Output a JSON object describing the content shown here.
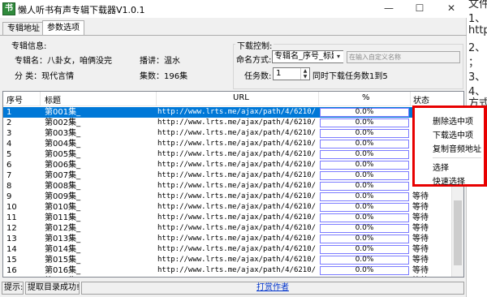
{
  "window": {
    "title": "懒人听书有声专辑下载器V1.0.1",
    "app_icon_char": "书",
    "minimize_glyph": "—",
    "maximize_glyph": "☐",
    "close_glyph": "✕"
  },
  "tabs": [
    {
      "label": "专辑地址"
    },
    {
      "label": "参数选项"
    }
  ],
  "album_info": {
    "header": "专辑信息:",
    "name_label": "专辑名：八卦女，咱俩没完",
    "host_label": "播讲：温水",
    "category_label": "分   类：现代言情",
    "episodes_label": "集数：196集"
  },
  "download_control": {
    "header": "下载控制:",
    "naming_label": "命名方式:",
    "naming_value": "专辑名_序号_标题",
    "naming_arrow": "▾",
    "custom_name_placeholder": "在输入自定义名称",
    "tasks_label": "任务数:",
    "tasks_value": "1",
    "spin_up": "▲",
    "spin_down": "▼",
    "tasks_hint": "同时下载任务数1到5"
  },
  "table": {
    "columns": [
      "序号",
      "标题",
      "URL",
      "%",
      "状态"
    ],
    "rows": [
      {
        "num": "1",
        "title": "第001集_",
        "url": "http://www.lrts.me/ajax/path/4/6210/3...",
        "pct": "0.0%",
        "status": ""
      },
      {
        "num": "2",
        "title": "第002集_",
        "url": "http://www.lrts.me/ajax/path/4/6210/3...",
        "pct": "0.0%",
        "status": ""
      },
      {
        "num": "3",
        "title": "第003集_",
        "url": "http://www.lrts.me/ajax/path/4/6210/3...",
        "pct": "0.0%",
        "status": ""
      },
      {
        "num": "4",
        "title": "第004集_",
        "url": "http://www.lrts.me/ajax/path/4/6210/3...",
        "pct": "0.0%",
        "status": ""
      },
      {
        "num": "5",
        "title": "第005集_",
        "url": "http://www.lrts.me/ajax/path/4/6210/3...",
        "pct": "0.0%",
        "status": ""
      },
      {
        "num": "6",
        "title": "第006集_",
        "url": "http://www.lrts.me/ajax/path/4/6210/3...",
        "pct": "0.0%",
        "status": ""
      },
      {
        "num": "7",
        "title": "第007集_",
        "url": "http://www.lrts.me/ajax/path/4/6210/3...",
        "pct": "0.0%",
        "status": ""
      },
      {
        "num": "8",
        "title": "第008集_",
        "url": "http://www.lrts.me/ajax/path/4/6210/3...",
        "pct": "0.0%",
        "status": ""
      },
      {
        "num": "9",
        "title": "第009集_",
        "url": "http://www.lrts.me/ajax/path/4/6210/3...",
        "pct": "0.0%",
        "status": "等待"
      },
      {
        "num": "10",
        "title": "第010集_",
        "url": "http://www.lrts.me/ajax/path/4/6210/3...",
        "pct": "0.0%",
        "status": "等待"
      },
      {
        "num": "11",
        "title": "第011集_",
        "url": "http://www.lrts.me/ajax/path/4/6210/3...",
        "pct": "0.0%",
        "status": "等待"
      },
      {
        "num": "12",
        "title": "第012集_",
        "url": "http://www.lrts.me/ajax/path/4/6210/3...",
        "pct": "0.0%",
        "status": "等待"
      },
      {
        "num": "13",
        "title": "第013集_",
        "url": "http://www.lrts.me/ajax/path/4/6210/3...",
        "pct": "0.0%",
        "status": "等待"
      },
      {
        "num": "14",
        "title": "第014集_",
        "url": "http://www.lrts.me/ajax/path/4/6210/3...",
        "pct": "0.0%",
        "status": "等待"
      },
      {
        "num": "15",
        "title": "第015集_",
        "url": "http://www.lrts.me/ajax/path/4/6210/3...",
        "pct": "0.0%",
        "status": "等待"
      },
      {
        "num": "16",
        "title": "第016集_",
        "url": "http://www.lrts.me/ajax/path/4/6210/3...",
        "pct": "0.0%",
        "status": "等待"
      },
      {
        "num": "17",
        "title": "第017集_",
        "url": "http://www.lrts.me/ajax/path/4/6210/3...",
        "pct": "0.0%",
        "status": "等待"
      }
    ],
    "selected_row": 0
  },
  "context_menu": {
    "items": [
      "删除选中项",
      "下载选中项",
      "复制音频地址",
      "选择",
      "快速选择"
    ]
  },
  "status_bar": {
    "hint": "提示:",
    "message": "提取目录成功!",
    "link": "打赏作者"
  },
  "background_doc": {
    "lines": [
      "文件",
      "1、",
      "http",
      "2、",
      "；",
      "3、",
      "4、",
      "方式"
    ]
  },
  "colors": {
    "selection": "#0078d7",
    "highlight_border": "#e80000",
    "link": "#0033cc",
    "progress_border": "#7c7cff"
  }
}
